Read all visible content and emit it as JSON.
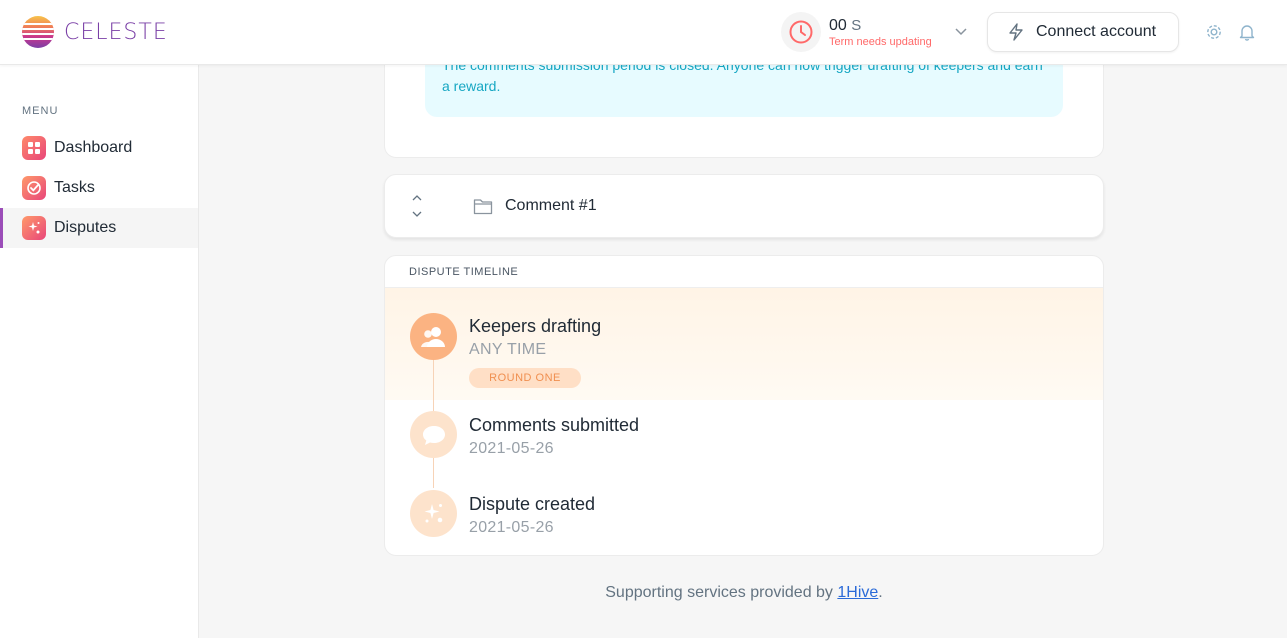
{
  "app": {
    "name": "CELESTE"
  },
  "clock": {
    "value": "00",
    "unit": "S",
    "status": "Term needs updating",
    "accent": "#ff6969"
  },
  "header": {
    "connect_label": "Connect account"
  },
  "sidebar": {
    "title": "MENU",
    "items": [
      {
        "label": "Dashboard",
        "icon": "dashboard-icon",
        "active": false
      },
      {
        "label": "Tasks",
        "icon": "tasks-icon",
        "active": false
      },
      {
        "label": "Disputes",
        "icon": "disputes-icon",
        "active": true
      }
    ]
  },
  "info": {
    "text": "The comments submission period is closed. Anyone can now trigger drafting of keepers and earn a reward."
  },
  "comment": {
    "label": "Comment #1"
  },
  "timeline": {
    "title": "DISPUTE TIMELINE",
    "items": [
      {
        "name": "Keepers drafting",
        "sub": "ANY TIME",
        "badge": "ROUND ONE",
        "icon": "keepers-icon",
        "active": true
      },
      {
        "name": "Comments submitted",
        "sub": "2021-05-26",
        "icon": "comment-bubble-icon",
        "active": false
      },
      {
        "name": "Dispute created",
        "sub": "2021-05-26",
        "icon": "dispute-created-icon",
        "active": false
      }
    ]
  },
  "footer": {
    "prefix": "Supporting services provided by ",
    "link": "1Hive",
    "suffix": "."
  },
  "colors": {
    "brand": "#7a3fa6",
    "timeline_accent": "#fbb382",
    "info_text": "#17a7c3"
  }
}
